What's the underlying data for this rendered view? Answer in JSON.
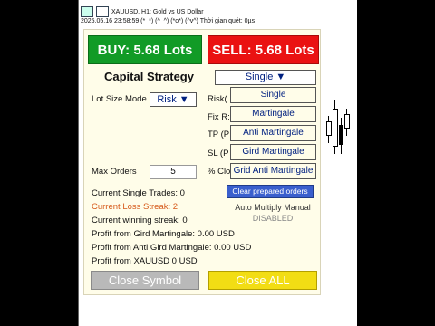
{
  "chart": {
    "title": "XAUUSD, H1:  Gold vs US Dollar",
    "info": "2025.05.16 23:58:59 (*_*) (^_^) (*o*) (^v^) Thời gian quét: 0µs"
  },
  "panel": {
    "buy_label": "BUY: 5.68 Lots",
    "sell_label": "SELL: 5.68 Lots",
    "strategy_title": "Capital Strategy",
    "strategy_selected": "Single ▼",
    "lot_size_mode_label": "Lot Size Mode",
    "lot_size_mode_value": "Risk ▼",
    "risk_label": "Risk(",
    "fixr_label": "Fix R:",
    "tp_label": "TP (P",
    "sl_label": "SL (P",
    "pclo_label": "% Clo",
    "max_orders_label": "Max Orders",
    "max_orders_value": "5",
    "strategy_options": [
      "Single",
      "Martingale",
      "Anti Martingale",
      "Gird Martingale",
      "Grid Anti Martingale"
    ],
    "clear_label": "Clear prepared orders",
    "auto_label": "Auto Multiply Manual",
    "disabled_label": "DISABLED",
    "stats": {
      "single_trades": "Current Single Trades: 0",
      "loss_streak": "Current Loss Streak: 2",
      "winning_streak": "Current winning streak: 0",
      "profit_gird": "Profit from Gird Martingale: 0.00 USD",
      "profit_anti_gird": "Profit from Anti Gird Martingale: 0.00 USD",
      "profit_xauusd": "Profit from XAUUSD 0 USD"
    },
    "close_symbol_label": "Close Symbol",
    "close_all_label": "Close ALL"
  },
  "colors": {
    "buy": "#119b26",
    "sell": "#ea1212",
    "clear": "#3a5fcd",
    "close_all": "#f2dd14",
    "close_symbol": "#b9b9b9",
    "loss_streak": "#d65a1a"
  }
}
